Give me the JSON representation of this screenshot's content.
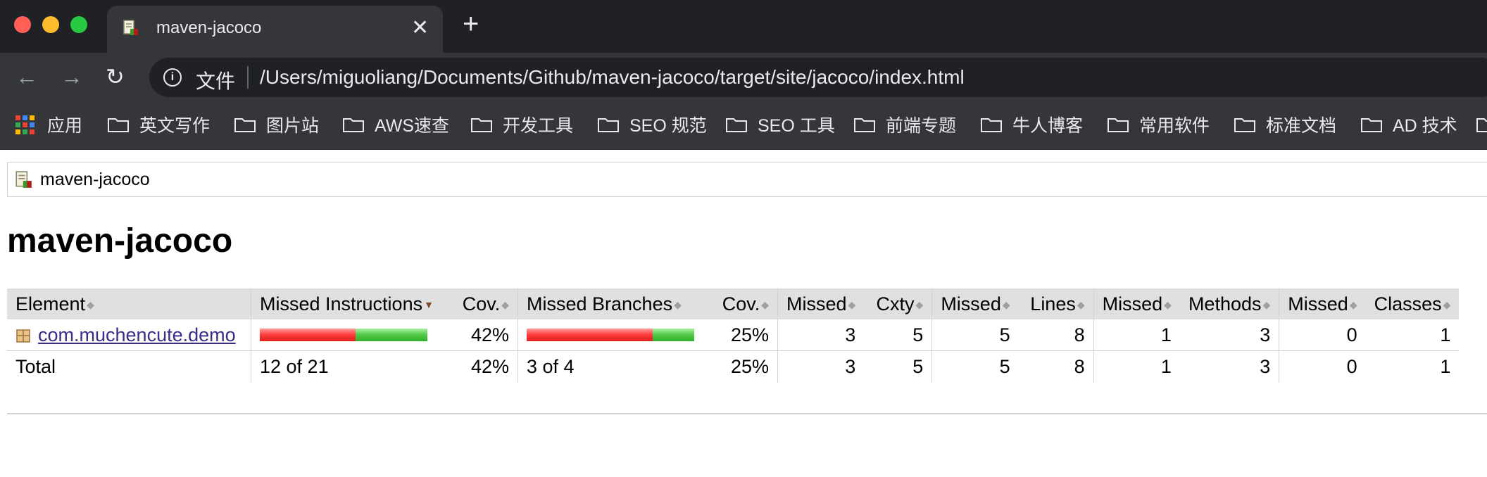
{
  "window": {
    "traffic_lights": [
      "#ff5f57",
      "#febc2e",
      "#28c840"
    ]
  },
  "tab": {
    "title": "maven-jacoco",
    "close_label": "✕",
    "new_tab_label": "+"
  },
  "toolbar": {
    "back_icon": "←",
    "forward_icon": "→",
    "reload_icon": "↻",
    "info_icon": "i",
    "url_scheme_label": "文件",
    "url": "/Users/miguoliang/Documents/Github/maven-jacoco/target/site/jacoco/index.html"
  },
  "bookmarks": {
    "items": [
      {
        "label": "应用"
      },
      {
        "label": "英文写作"
      },
      {
        "label": "图片站"
      },
      {
        "label": "AWS速查"
      },
      {
        "label": "开发工具"
      },
      {
        "label": "SEO 规范"
      },
      {
        "label": "SEO 工具"
      },
      {
        "label": "前端专题"
      },
      {
        "label": "牛人博客"
      },
      {
        "label": "常用软件"
      },
      {
        "label": "标准文档"
      },
      {
        "label": "AD 技术"
      }
    ]
  },
  "page": {
    "breadcrumb": "maven-jacoco",
    "title": "maven-jacoco",
    "table": {
      "headers": {
        "element": "Element",
        "missed_instructions": "Missed Instructions",
        "cov1": "Cov.",
        "missed_branches": "Missed Branches",
        "cov2": "Cov.",
        "missed_cxty": "Missed",
        "cxty": "Cxty",
        "missed_lines": "Missed",
        "lines": "Lines",
        "missed_methods": "Missed",
        "methods": "Methods",
        "missed_classes": "Missed",
        "classes": "Classes"
      },
      "rows": [
        {
          "element": "com.muchencute.demo",
          "instructions_missed_fraction": 0.57,
          "instructions_cov": "42%",
          "branches_missed_fraction": 0.75,
          "branches_cov": "25%",
          "missed_cxty": "3",
          "cxty": "5",
          "missed_lines": "5",
          "lines": "8",
          "missed_methods": "1",
          "methods": "3",
          "missed_classes": "0",
          "classes": "1"
        }
      ],
      "total": {
        "label": "Total",
        "instructions": "12 of 21",
        "instructions_cov": "42%",
        "branches": "3 of 4",
        "branches_cov": "25%",
        "missed_cxty": "3",
        "cxty": "5",
        "missed_lines": "5",
        "lines": "8",
        "missed_methods": "1",
        "methods": "3",
        "missed_classes": "0",
        "classes": "1"
      }
    }
  }
}
